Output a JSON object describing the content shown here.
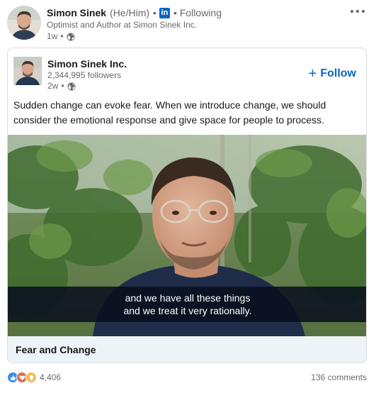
{
  "author": {
    "name": "Simon Sinek",
    "pronouns": "(He/Him)",
    "separator": "•",
    "badge": "in",
    "following": "Following",
    "headline": "Optimist and Author at Simon Sinek Inc.",
    "time": "1w",
    "time_separator": "•",
    "visibility_icon": "globe-icon",
    "more_icon": "overflow-menu-icon"
  },
  "shared": {
    "company_name": "Simon Sinek Inc.",
    "followers": "2,344,995 followers",
    "time": "2w",
    "time_separator": "•",
    "follow_plus": "+",
    "follow_label": "Follow",
    "text": "Sudden change can evoke fear. When we introduce change, we should consider the emotional response and give space for people to process.",
    "video": {
      "caption_line1": "and we have all these things",
      "caption_line2": "and we treat it very rationally.",
      "title": "Fear and Change"
    }
  },
  "social": {
    "reactions": [
      "like-icon",
      "love-icon",
      "insightful-icon"
    ],
    "reaction_count": "4,406",
    "comments": "136 comments"
  },
  "colors": {
    "accent": "#0a66c2",
    "secondary_text": "#666666",
    "video_footer": "#eef3f8"
  }
}
